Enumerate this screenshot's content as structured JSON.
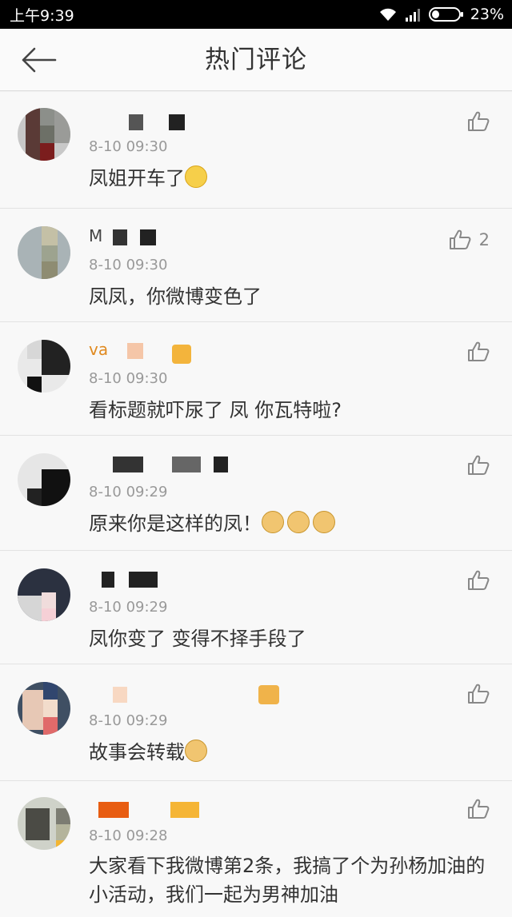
{
  "status_bar": {
    "time": "上午9:39",
    "battery_percent": "23%",
    "colors": {
      "background": "#000000",
      "text": "#ffffff"
    }
  },
  "header": {
    "title": "热门评论",
    "back_icon": "arrow-left-icon"
  },
  "comments": [
    {
      "time": "8-10 09:30",
      "text": "凤姐开车了",
      "emoji": "grin-emoji",
      "likes": ""
    },
    {
      "username_partial": "M",
      "time": "8-10 09:30",
      "text": "凤凤，你微博变色了",
      "likes": "2"
    },
    {
      "username_partial": "va",
      "time": "8-10 09:30",
      "text": "看标题就吓尿了  凤  你瓦特啦?",
      "likes": ""
    },
    {
      "time": "8-10 09:29",
      "text": "原来你是这样的凤！",
      "emoji": "doge-emoji x3",
      "likes": ""
    },
    {
      "time": "8-10 09:29",
      "text": "凤你变了 变得不择手段了",
      "likes": ""
    },
    {
      "time": "8-10 09:29",
      "text": "故事会转载",
      "emoji": "doge-emoji",
      "likes": ""
    },
    {
      "time": "8-10 09:28",
      "text": "大家看下我微博第2条，我搞了个为孙杨加油的小活动，我们一起为男神加油",
      "likes": ""
    }
  ],
  "icons": {
    "like": "thumbs-up-icon"
  },
  "colors": {
    "page_bg": "#f8f8f8",
    "time_text": "#999999",
    "comment_text": "#333333",
    "divider": "#e3e3e3"
  }
}
